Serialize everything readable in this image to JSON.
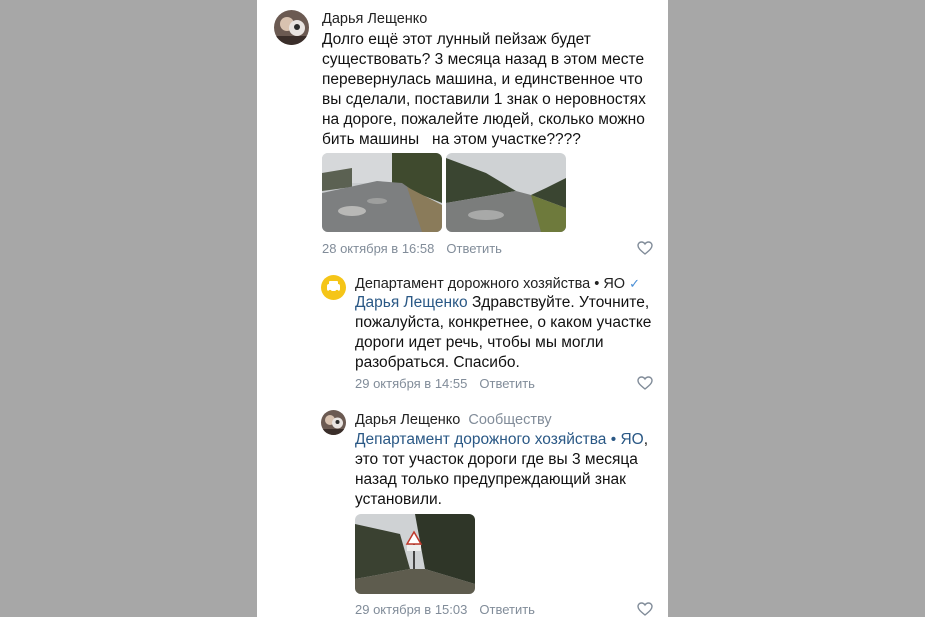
{
  "comment1": {
    "author": "Дарья Лещенко",
    "text_lines": [
      "Долго ещё этот лунный пейзаж будет",
      "существовать? 3 месяца назад в этом месте",
      "перевернулась машина, и единственное что",
      "вы сделали, поставили 1 знак о неровностях",
      "на дороге, пожалейте людей, сколько можно",
      "бить машины   на этом участке????"
    ],
    "timestamp": "28 октября в 16:58",
    "reply_label": "Ответить"
  },
  "reply1": {
    "author": "Департамент дорожного хозяйства • ЯО",
    "verified_icon": "✓",
    "mention": "Дарья Лещенко",
    "text_first": " Здравствуйте. Уточните,",
    "text_lines": [
      "пожалуйста, конкретнее, о каком участке",
      "дороги идет речь, чтобы мы могли",
      "разобраться. Спасибо."
    ],
    "timestamp": "29 октября в 14:55",
    "reply_label": "Ответить"
  },
  "reply2": {
    "author": "Дарья Лещенко",
    "addressee": "Сообществу",
    "mention": "Департамент дорожного хозяйства • ЯО",
    "mention_suffix": ",",
    "text_lines": [
      "это тот участок дороги где вы 3 месяца",
      "назад только предупреждающий знак",
      "установили."
    ],
    "timestamp": "29 октября в 15:03",
    "reply_label": "Ответить"
  },
  "colors": {
    "background": "#a7a7a7",
    "panel": "#ffffff",
    "link": "#2a5885",
    "meta": "#818c99",
    "department_avatar": "#f5c518"
  }
}
